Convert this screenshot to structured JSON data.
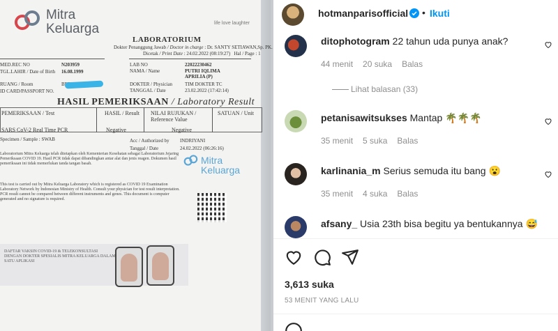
{
  "post": {
    "author": "hotmanparisofficial",
    "verified_icon": "verified-badge-icon",
    "dot": "•",
    "follow_label": "Ikuti",
    "more_icon": "more-options-icon",
    "likes_label": "3,613 suka",
    "time_ago": "53 MENIT YANG LALU",
    "accent": "#0095f6"
  },
  "comments": [
    {
      "user": "ditophotogram",
      "text": "22 tahun uda punya anak?",
      "time": "44 menit",
      "likes": "20 suka",
      "reply": "Balas",
      "view_replies": "Lihat balasan (33)"
    },
    {
      "user": "petanisawitsukses",
      "text": "Mantap",
      "emoji": "🌴🌴🌴",
      "time": "35 menit",
      "likes": "5 suka",
      "reply": "Balas"
    },
    {
      "user": "karlinania_m",
      "text": "Serius semuda itu bang",
      "emoji": "😮",
      "time": "35 menit",
      "likes": "4 suka",
      "reply": "Balas"
    },
    {
      "user": "afsany_",
      "text": "Usia 23th bisa begitu ya bentukannya",
      "emoji": "😅"
    }
  ],
  "document": {
    "logo_line1": "Mitra",
    "logo_line2": "Keluarga",
    "tagline": "life love laughter",
    "title": "LABORATORIUM",
    "doctor_label": "Dokter Penanggung Jawab",
    "doctor_label_en": "/ Doctor in charge",
    "doctor": "Dr. SANTY SETIAWAN,Sp. PK.",
    "printed_label": "Dicetak",
    "print_date_label": "/ Print Date",
    "print_date": "24.02.2022 (08:19:27)",
    "page_label": "Hal / Page",
    "page": "1",
    "med_rec_label": "MED.REC NO",
    "med_rec": "N203959",
    "dob_label": "TGL.LAHIR / Date of Birth",
    "dob": "16.08.1999",
    "room_label": "RUANG / Room",
    "room": "BEBAS",
    "id_label": "ID CARD/PASSPORT NO.",
    "lab_no_label": "LAB NO",
    "lab_no": "22022230462",
    "name_label": "NAMA / Name",
    "name": "PUTRI IQLIMA APRILIA (P)",
    "doctor2_label": "DOKTER / Physician",
    "doctor2": "TIM DOKTER TC",
    "date_label": "TANGGAL / Date",
    "date": "23.02.2022 (17:42:14)",
    "results_title": "HASIL PEMERIKSAAN",
    "results_title_en": "/ Laboratory Result",
    "col_test": "PEMERIKSAAN / Test",
    "col_result": "HASIL / Result",
    "col_ref": "NILAI RUJUKAN / Reference Value",
    "col_unit": "SATUAN / Unit",
    "test_name": "SARS CoV-2 Real Time PCR",
    "test_result": "Negative",
    "test_ref": "Negative",
    "specimen_label": "Specimen / Sample :",
    "specimen": "SWAB",
    "acc_label": "Acc / Authorized by",
    "acc": "INDRIYANI",
    "acc_date_label": "Tanggal / Date",
    "acc_date": "24.02.2022 (06:26:16)",
    "para_id": "Laboratorium Mitra Keluarga telah ditetapkan oleh Kementerian Kesehatan sebagai Laboratorium Jejaring Pemeriksaan COVID 19. Hasil PCR tidak dapat dibandingkan antar alat dan jenis reagen. Dokumen hasil pemeriksaan ini tidak memerlukan tanda tangan basah.",
    "para_en": "This test is carried out by Mitra Keluarga Laboratory which is registered as COVID 19 Examination Laboratory Network by Indonesian Ministry of Health. Consult your physician for test result interpretation. PCR result cannot be compared between different instruments and genes. This document is computer generated and no signature is required.",
    "banner_text": "DAFTAR VAKSIN COVID-19 & TELEKONSULTASI DENGAN DOKTER SPESIALIS MITRA KELUARGA DALAM SATU APLIKASI"
  }
}
